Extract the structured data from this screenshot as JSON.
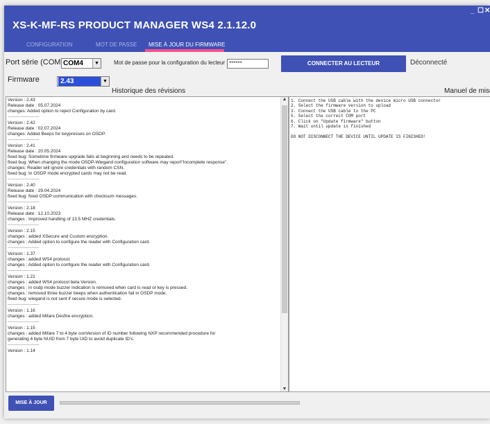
{
  "window": {
    "title": "XS-K-MF-RS   PRODUCT MANAGER WS4 2.1.12.0",
    "min": "_",
    "max": "☐",
    "close": "✕"
  },
  "tabs": [
    {
      "label": "CONFIGURATION"
    },
    {
      "label": "MOT DE PASSE"
    },
    {
      "label": "MISE À JOUR DU FIRMWARE",
      "active": true
    }
  ],
  "colors": {
    "primary": "#3f51b5",
    "tab_indicator": "#ff4f8b",
    "selection": "#2b4fd8"
  },
  "connection": {
    "port_label": "Port série (COM)",
    "port_value": "COM4",
    "password_label": "Mot de passe pour la configuration du lecteur",
    "password_value": "******",
    "connect_button": "CONNECTER AU LECTEUR",
    "status": "Déconnecté"
  },
  "firmware": {
    "label": "Firmware",
    "value": "2.43"
  },
  "history": {
    "title": "Historique des révisions",
    "separator": "---------------------",
    "entries": [
      {
        "lines": [
          "Version : 2.43",
          "Release date : 05.07.2024",
          "changes: Added option to reject Configuration by card."
        ]
      },
      {
        "lines": [
          "Version : 2.42",
          "Release date : 02.07.2024",
          "changes: Added Beeps for keypresses on OSDP."
        ]
      },
      {
        "lines": [
          "Version : 2.41",
          "Release date : 20.05.2024",
          "fixed bug: Sometime firmware upgrade fails at beginning and needs to be repeated.",
          "fixed bug: When changing the mode OSDP-Wiegand configuration software may report\"Incomplete response\".",
          "changes: Reader will ignore credentials with random CSN.",
          "fixed bug: In OSDP mode encrypted cards may not be read."
        ]
      },
      {
        "lines": [
          "Version : 2.40",
          "Release date : 29.04.2024",
          "fixed bug: fixed OSDP communication with checksum messages."
        ]
      },
      {
        "lines": [
          "Version : 2.18",
          "Release date : 12.10.2023",
          "changes : Improved handling of 13.5 MHZ credentials."
        ]
      },
      {
        "lines": [
          "Version : 2.15",
          "changes : added XSecure and Custom encryption.",
          "changes : Added option to configure the reader with Configuration card."
        ]
      },
      {
        "lines": [
          "Version : 1.37",
          "changes : added WS4 protocol.",
          "changes : Added option to configure the reader with Configuration card."
        ]
      },
      {
        "lines": [
          "Version : 1.21",
          "changes : added WS4 protocol beta Version.",
          "changes : in osdp mode buzzer indication is removed when card is read or key is pressed.",
          "changes : removed three buzzer beeps when authentication fail in OSDP mode.",
          "fixed bug: wiegand is not sent if secure mode is selected."
        ]
      },
      {
        "lines": [
          "Version : 1.16",
          "changes : added Mifare Desfire encryption."
        ]
      },
      {
        "lines": [
          "Version : 1.15",
          "changes : added Mifare 7 to 4 byte conVersion of ID number following NXP recommended procedure for",
          "generating 4 byte NUID from 7 byte UID to avoid duplicate ID's."
        ]
      },
      {
        "lines": [
          "Version : 1.14"
        ]
      }
    ]
  },
  "manual": {
    "title": "Manuel de mise",
    "lines": [
      "1. Connect the USB cable with the device micro USB connector",
      "2. Select the firmware version to upload",
      "3. Connect the USB cable to the PC",
      "5. Select the correct COM port",
      "6. Click on \"Update firmware\" button",
      "7. Wait until update is finished",
      "",
      "DO NOT DISCONNECT THE DEVICE UNTIL UPDATE IS FINISHED!"
    ]
  },
  "update_button": "MISE À JOUR",
  "progress": 0
}
